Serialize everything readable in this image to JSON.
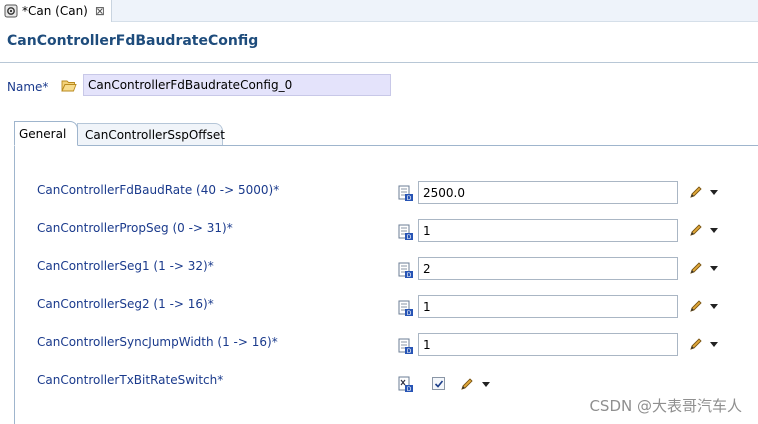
{
  "editor_tab": {
    "title": "*Can (Can)",
    "close_symbol": "⊠"
  },
  "page_title": "CanControllerFdBaudrateConfig",
  "name_field": {
    "label": "Name*",
    "value": "CanControllerFdBaudrateConfig_0"
  },
  "tabs": [
    {
      "label": "General",
      "active": true
    },
    {
      "label": "CanControllerSspOffset",
      "active": false
    }
  ],
  "params": [
    {
      "label": "CanControllerFdBaudRate (40 -> 5000)*",
      "value": "2500.0"
    },
    {
      "label": "CanControllerPropSeg (0 -> 31)*",
      "value": "1"
    },
    {
      "label": "CanControllerSeg1 (1 -> 32)*",
      "value": "2"
    },
    {
      "label": "CanControllerSeg2 (1 -> 16)*",
      "value": "1"
    },
    {
      "label": "CanControllerSyncJumpWidth (1 -> 16)*",
      "value": "1"
    }
  ],
  "bool_param": {
    "label": "CanControllerTxBitRateSwitch*",
    "checked": true
  },
  "watermark": "CSDN @大表哥汽车人",
  "colors": {
    "label_blue": "#1a3a8c",
    "title_blue": "#1e4c7c",
    "name_bg": "#e4e3fb"
  }
}
